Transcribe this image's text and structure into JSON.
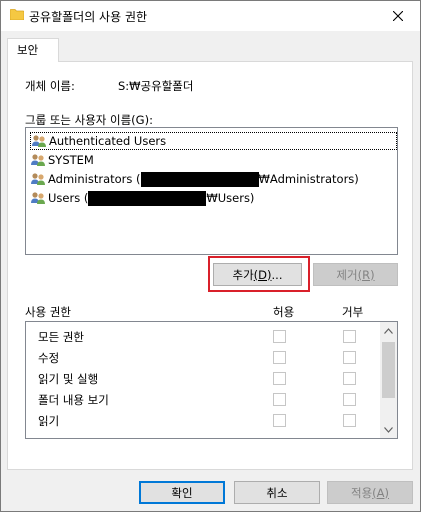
{
  "window": {
    "title": "공유할폴더의 사용 권한",
    "folder_color": "#f5c842"
  },
  "tabs": [
    {
      "label": "보안"
    }
  ],
  "object": {
    "label": "개체 이름:",
    "value": "S:₩공유할폴더"
  },
  "groups": {
    "label": "그룹 또는 사용자 이름(G):",
    "items": [
      {
        "prefix": "Authenticated Users",
        "suffix": ""
      },
      {
        "prefix": "SYSTEM",
        "suffix": ""
      },
      {
        "prefix": "Administrators (",
        "suffix": "₩Administrators)"
      },
      {
        "prefix": "Users (",
        "suffix": "₩Users)"
      }
    ]
  },
  "buttons": {
    "add": {
      "label": "추가",
      "mnemonic": "(D)",
      "ellipsis": "..."
    },
    "remove": {
      "label": "제거",
      "mnemonic": "(R)"
    },
    "ok": "확인",
    "cancel": "취소",
    "apply": {
      "label": "적용",
      "mnemonic": "(A)"
    }
  },
  "permissions": {
    "header": "사용 권한",
    "allow_header": "허용",
    "deny_header": "거부",
    "rows": [
      {
        "label": "모든 권한"
      },
      {
        "label": "수정"
      },
      {
        "label": "읽기 및 실행"
      },
      {
        "label": "폴더 내용 보기"
      },
      {
        "label": "읽기"
      }
    ]
  },
  "highlight_color": "#d9202a"
}
